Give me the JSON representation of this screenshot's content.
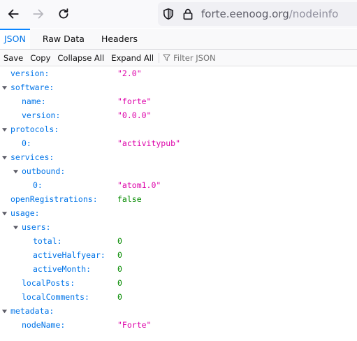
{
  "browser": {
    "url_host": "forte.eenoog.org",
    "url_path": "/nodeinfo"
  },
  "viewer": {
    "tabs": [
      "JSON",
      "Raw Data",
      "Headers"
    ],
    "selected_tab": "JSON",
    "toolbar": {
      "save": "Save",
      "copy": "Copy",
      "collapse_all": "Collapse All",
      "expand_all": "Expand All",
      "filter_placeholder": "Filter JSON"
    }
  },
  "rows": [
    {
      "key": "version:",
      "value": "\"2.0\"",
      "type": "string",
      "depth": 0,
      "expandable": false
    },
    {
      "key": "software:",
      "value": "",
      "type": "object",
      "depth": 0,
      "expandable": true
    },
    {
      "key": "name:",
      "value": "\"forte\"",
      "type": "string",
      "depth": 1,
      "expandable": false
    },
    {
      "key": "version:",
      "value": "\"0.0.0\"",
      "type": "string",
      "depth": 1,
      "expandable": false
    },
    {
      "key": "protocols:",
      "value": "",
      "type": "object",
      "depth": 0,
      "expandable": true
    },
    {
      "key": "0:",
      "value": "\"activitypub\"",
      "type": "string",
      "depth": 1,
      "expandable": false
    },
    {
      "key": "services:",
      "value": "",
      "type": "object",
      "depth": 0,
      "expandable": true
    },
    {
      "key": "outbound:",
      "value": "",
      "type": "object",
      "depth": 1,
      "expandable": true
    },
    {
      "key": "0:",
      "value": "\"atom1.0\"",
      "type": "string",
      "depth": 2,
      "expandable": false
    },
    {
      "key": "openRegistrations:",
      "value": "false",
      "type": "bool",
      "depth": 0,
      "expandable": false
    },
    {
      "key": "usage:",
      "value": "",
      "type": "object",
      "depth": 0,
      "expandable": true
    },
    {
      "key": "users:",
      "value": "",
      "type": "object",
      "depth": 1,
      "expandable": true
    },
    {
      "key": "total:",
      "value": "0",
      "type": "number",
      "depth": 2,
      "expandable": false
    },
    {
      "key": "activeHalfyear:",
      "value": "0",
      "type": "number",
      "depth": 2,
      "expandable": false
    },
    {
      "key": "activeMonth:",
      "value": "0",
      "type": "number",
      "depth": 2,
      "expandable": false
    },
    {
      "key": "localPosts:",
      "value": "0",
      "type": "number",
      "depth": 1,
      "expandable": false
    },
    {
      "key": "localComments:",
      "value": "0",
      "type": "number",
      "depth": 1,
      "expandable": false
    },
    {
      "key": "metadata:",
      "value": "",
      "type": "object",
      "depth": 0,
      "expandable": true
    },
    {
      "key": "nodeName:",
      "value": "\"Forte\"",
      "type": "string",
      "depth": 1,
      "expandable": false
    }
  ]
}
